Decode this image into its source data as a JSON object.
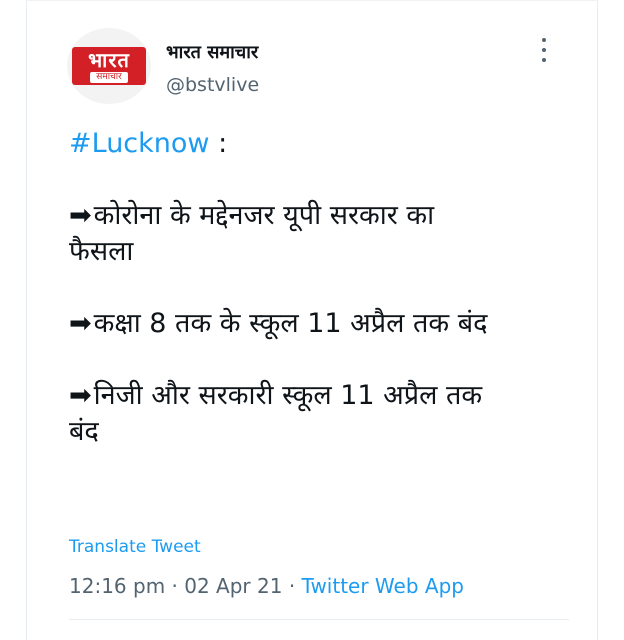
{
  "header": {
    "logo_text": "भारत",
    "logo_subtext": "समाचार",
    "display_name": "भारत समाचार",
    "handle": "@bstvlive"
  },
  "tweet": {
    "hashtag": "#Lucknow",
    "hashtag_suffix": " :",
    "arrow": "➡",
    "line1_a": "कोरोना के मद्देनजर यूपी सरकार का",
    "line1_b": "फैसला",
    "line2": "कक्षा 8 तक के स्कूल 11 अप्रैल तक बंद",
    "line3_a": "निजी और सरकारी स्कूल 11 अप्रैल तक",
    "line3_b": "बंद"
  },
  "translate_label": "Translate Tweet",
  "meta": {
    "time": "12:16 pm",
    "separator": " · ",
    "date": "02 Apr 21",
    "app": "Twitter Web App"
  },
  "icons": {
    "more": "more-vertical-icon"
  },
  "colors": {
    "link": "#1d9bf0",
    "secondary_text": "#536471",
    "logo_red": "#d32027"
  }
}
